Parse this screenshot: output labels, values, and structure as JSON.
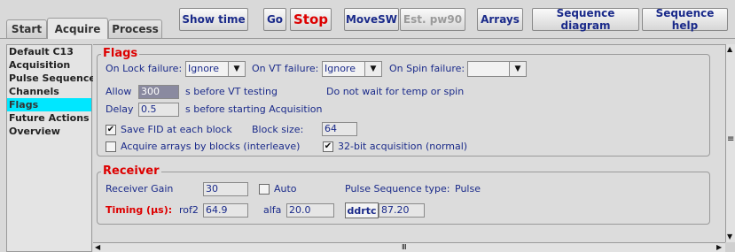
{
  "tabs": [
    {
      "label": "Start",
      "active": false
    },
    {
      "label": "Acquire",
      "active": true
    },
    {
      "label": "Process",
      "active": false
    }
  ],
  "toolbar": {
    "show_time": "Show time",
    "go": "Go",
    "stop": "Stop",
    "movesw": "MoveSW",
    "est_pw90": "Est. pw90",
    "arrays": "Arrays",
    "sequence_diagram": "Sequence diagram",
    "sequence_help": "Sequence help"
  },
  "sidebar": {
    "items": [
      {
        "label": "Default C13",
        "selected": false
      },
      {
        "label": "Acquisition",
        "selected": false
      },
      {
        "label": "Pulse Sequence",
        "selected": false
      },
      {
        "label": "Channels",
        "selected": false
      },
      {
        "label": "Flags",
        "selected": true
      },
      {
        "label": "Future Actions",
        "selected": false
      },
      {
        "label": "Overview",
        "selected": false
      }
    ]
  },
  "flags": {
    "title": "Flags",
    "on_lock_failure_label": "On Lock failure:",
    "on_lock_failure_value": "Ignore",
    "on_vt_failure_label": "On VT failure:",
    "on_vt_failure_value": "Ignore",
    "on_spin_failure_label": "On Spin failure:",
    "on_spin_failure_value": "",
    "allow_label": "Allow",
    "allow_value": "300",
    "allow_suffix": "s before VT testing",
    "no_wait_label": "Do not wait for temp or spin",
    "delay_label": "Delay",
    "delay_value": "0.5",
    "delay_suffix": "s before starting Acquisition",
    "save_fid_label": "Save FID at each block",
    "save_fid_checked": true,
    "block_size_label": "Block size:",
    "block_size_value": "64",
    "acquire_arrays_label": "Acquire arrays by blocks (interleave)",
    "acquire_arrays_checked": false,
    "bit32_label": "32-bit acquisition (normal)",
    "bit32_checked": true
  },
  "receiver": {
    "title": "Receiver",
    "gain_label": "Receiver Gain",
    "gain_value": "30",
    "auto_label": "Auto",
    "auto_checked": false,
    "pulse_seq_type_label": "Pulse Sequence type:",
    "pulse_seq_type_value": "Pulse",
    "timing_label": "Timing (µs):",
    "rof2_label": "rof2",
    "rof2_value": "64.9",
    "alfa_label": "alfa",
    "alfa_value": "20.0",
    "ddrtc_label": "ddrtc",
    "ddrtc_value": "87.20"
  },
  "icons": {
    "checked": "✔",
    "dropdown": "▼",
    "scroll_up": "▲",
    "scroll_down": "▼",
    "scroll_left": "◀",
    "scroll_right": "▶",
    "scroll_grip": "≡",
    "hscroll_grip": "Ⅲ"
  },
  "colors": {
    "accent_text": "#1a2a8a",
    "section_title": "#dd0000",
    "selection": "#00e7ff"
  }
}
